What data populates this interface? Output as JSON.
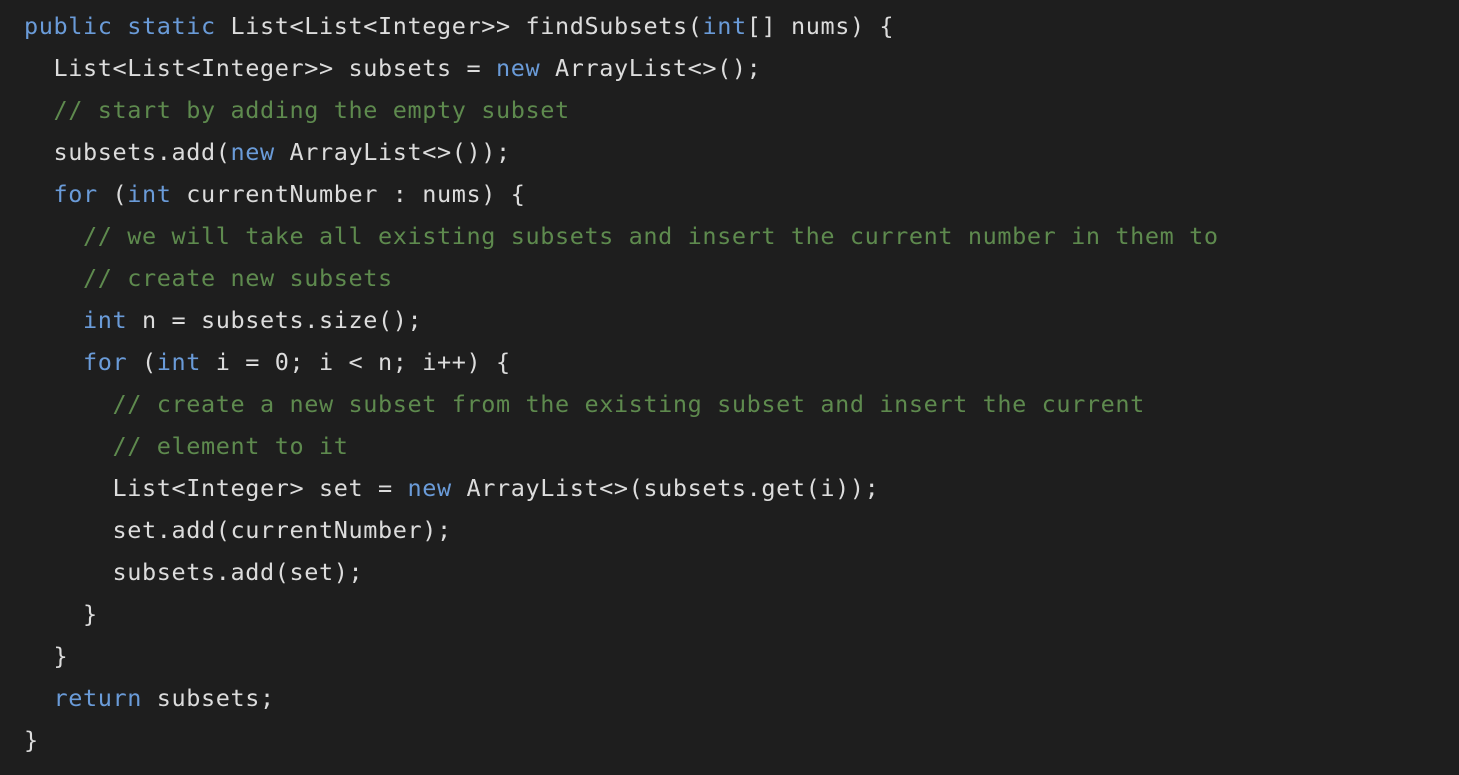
{
  "colors": {
    "background": "#1e1e1e",
    "keyword": "#6a9bd8",
    "comment": "#5e8a4e",
    "text": "#dcdcdc"
  },
  "code": {
    "lines": [
      [
        [
          "kw",
          "public"
        ],
        [
          "tx",
          " "
        ],
        [
          "kw",
          "static"
        ],
        [
          "tx",
          " List<List<Integer>> findSubsets("
        ],
        [
          "kw",
          "int"
        ],
        [
          "tx",
          "[] nums) {"
        ]
      ],
      [
        [
          "tx",
          "  List<List<Integer>> subsets = "
        ],
        [
          "kw",
          "new"
        ],
        [
          "tx",
          " ArrayList<>();"
        ]
      ],
      [
        [
          "tx",
          "  "
        ],
        [
          "cm",
          "// start by adding the empty subset"
        ]
      ],
      [
        [
          "tx",
          "  subsets.add("
        ],
        [
          "kw",
          "new"
        ],
        [
          "tx",
          " ArrayList<>());"
        ]
      ],
      [
        [
          "tx",
          "  "
        ],
        [
          "kw",
          "for"
        ],
        [
          "tx",
          " ("
        ],
        [
          "kw",
          "int"
        ],
        [
          "tx",
          " currentNumber : nums) {"
        ]
      ],
      [
        [
          "tx",
          "    "
        ],
        [
          "cm",
          "// we will take all existing subsets and insert the current number in them to"
        ]
      ],
      [
        [
          "tx",
          "    "
        ],
        [
          "cm",
          "// create new subsets"
        ]
      ],
      [
        [
          "tx",
          "    "
        ],
        [
          "kw",
          "int"
        ],
        [
          "tx",
          " n = subsets.size();"
        ]
      ],
      [
        [
          "tx",
          "    "
        ],
        [
          "kw",
          "for"
        ],
        [
          "tx",
          " ("
        ],
        [
          "kw",
          "int"
        ],
        [
          "tx",
          " i = 0; i < n; i++) {"
        ]
      ],
      [
        [
          "tx",
          "      "
        ],
        [
          "cm",
          "// create a new subset from the existing subset and insert the current"
        ]
      ],
      [
        [
          "tx",
          "      "
        ],
        [
          "cm",
          "// element to it"
        ]
      ],
      [
        [
          "tx",
          "      List<Integer> set = "
        ],
        [
          "kw",
          "new"
        ],
        [
          "tx",
          " ArrayList<>(subsets.get(i));"
        ]
      ],
      [
        [
          "tx",
          "      set.add(currentNumber);"
        ]
      ],
      [
        [
          "tx",
          "      subsets.add(set);"
        ]
      ],
      [
        [
          "tx",
          "    }"
        ]
      ],
      [
        [
          "tx",
          "  }"
        ]
      ],
      [
        [
          "tx",
          "  "
        ],
        [
          "kw",
          "return"
        ],
        [
          "tx",
          " subsets;"
        ]
      ],
      [
        [
          "tx",
          "}"
        ]
      ]
    ]
  }
}
